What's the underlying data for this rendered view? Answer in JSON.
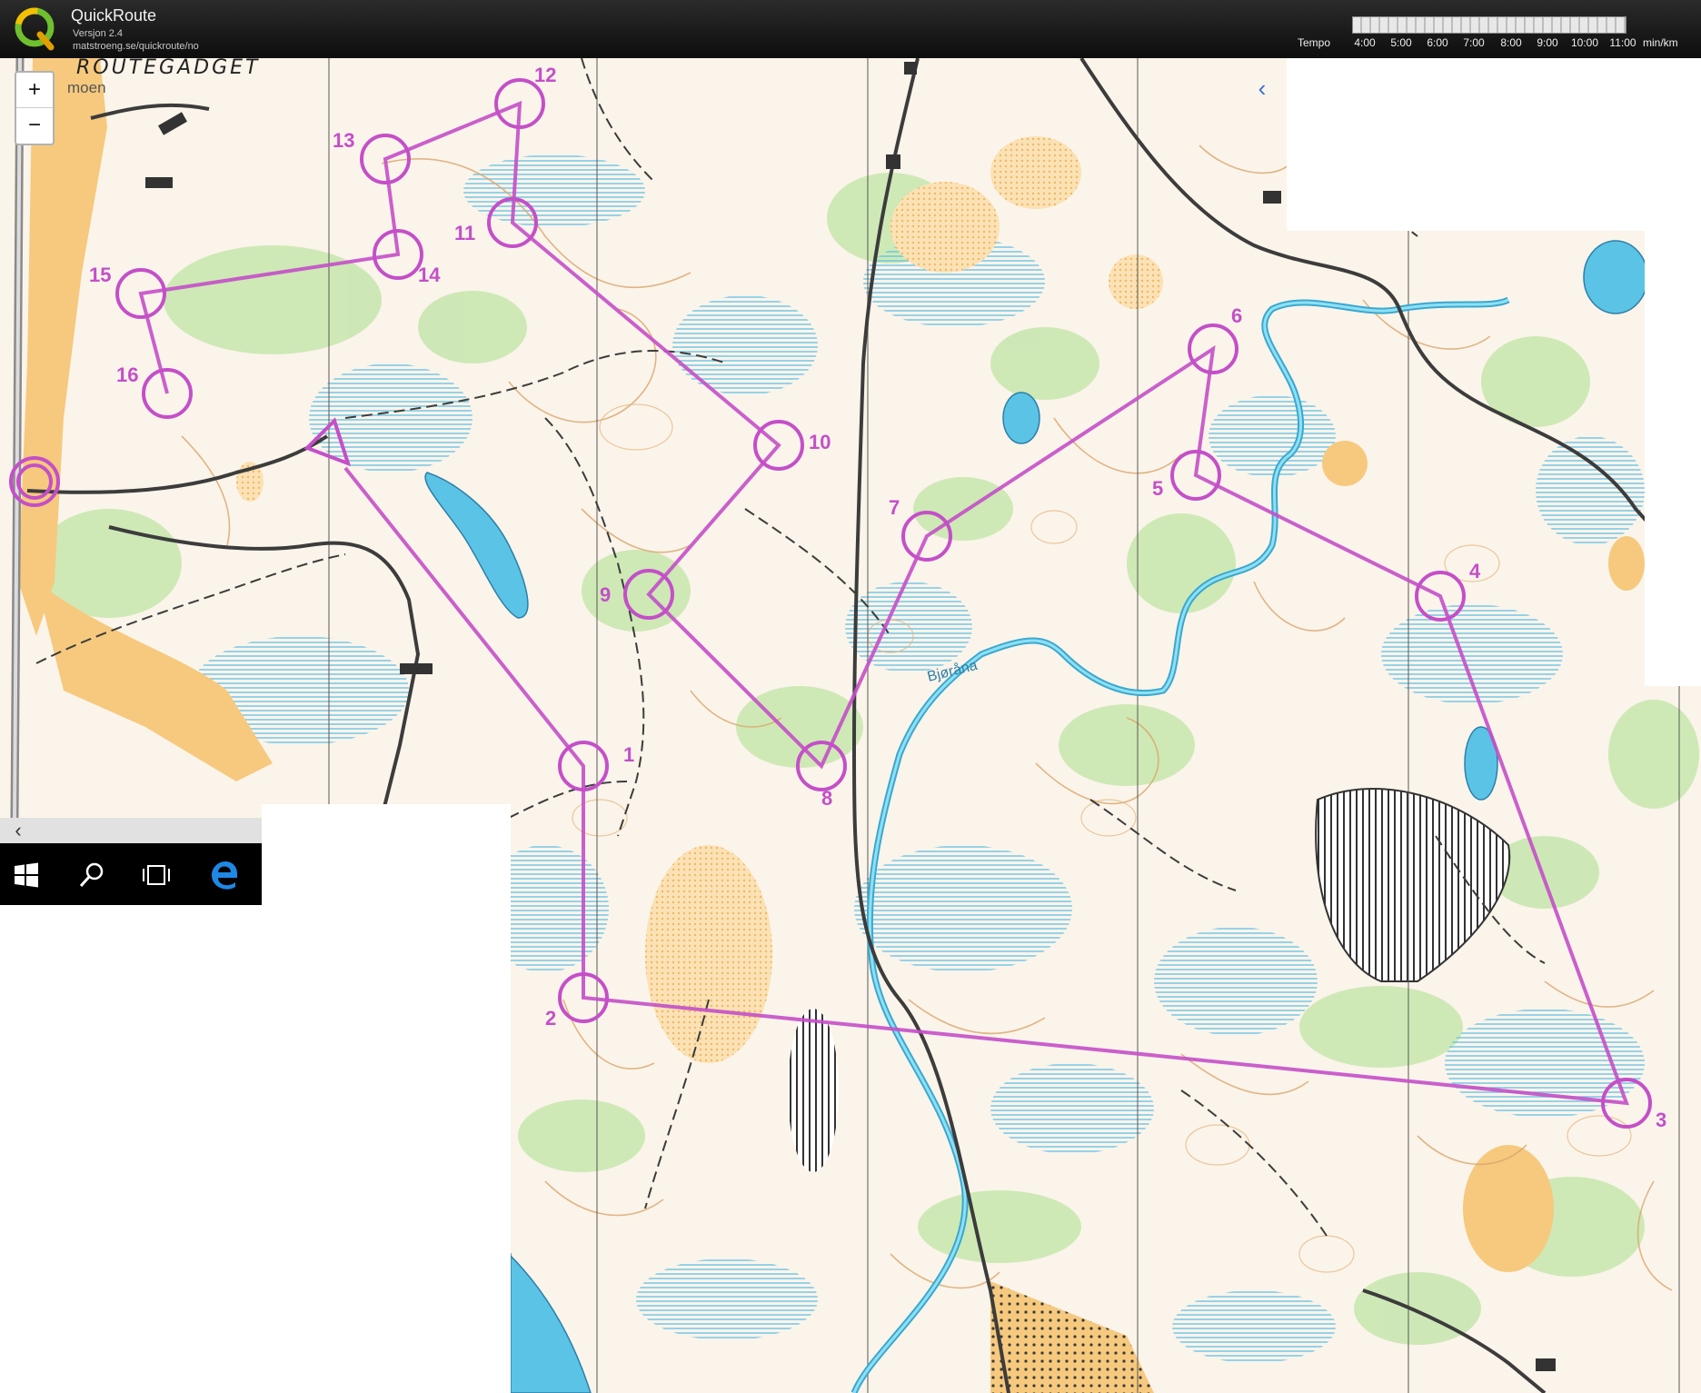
{
  "header": {
    "app_title": "QuickRoute",
    "version": "Versjon 2.4",
    "url": "matstroeng.se/quickroute/no",
    "tempo_label": "Tempo",
    "tempo_ticks": [
      "4:00",
      "5:00",
      "6:00",
      "7:00",
      "8:00",
      "9:00",
      "10:00",
      "11:00"
    ],
    "tempo_unit": "min/km"
  },
  "map": {
    "brand": "ROUTEGADGET",
    "place_label": "moen",
    "stream_label": "Bjøråna",
    "zoom_in_label": "+",
    "zoom_out_label": "−",
    "collapse_label": "‹",
    "scroll_left_label": "‹",
    "control_labels": [
      "1",
      "2",
      "3",
      "4",
      "5",
      "6",
      "7",
      "8",
      "9",
      "10",
      "11",
      "12",
      "13",
      "14",
      "15",
      "16"
    ]
  },
  "taskbar": {
    "icons": [
      "windows-start-icon",
      "search-icon",
      "task-view-icon",
      "edge-browser-icon"
    ]
  },
  "colors": {
    "course": "#c44fc8",
    "header_bg": "#1a1a1a",
    "map_base": "#fbf4ea",
    "green": "#bfe3a9",
    "open_land": "#f6c97e",
    "marsh_blue": "#8fd3ea",
    "water": "#5bc3e6"
  }
}
